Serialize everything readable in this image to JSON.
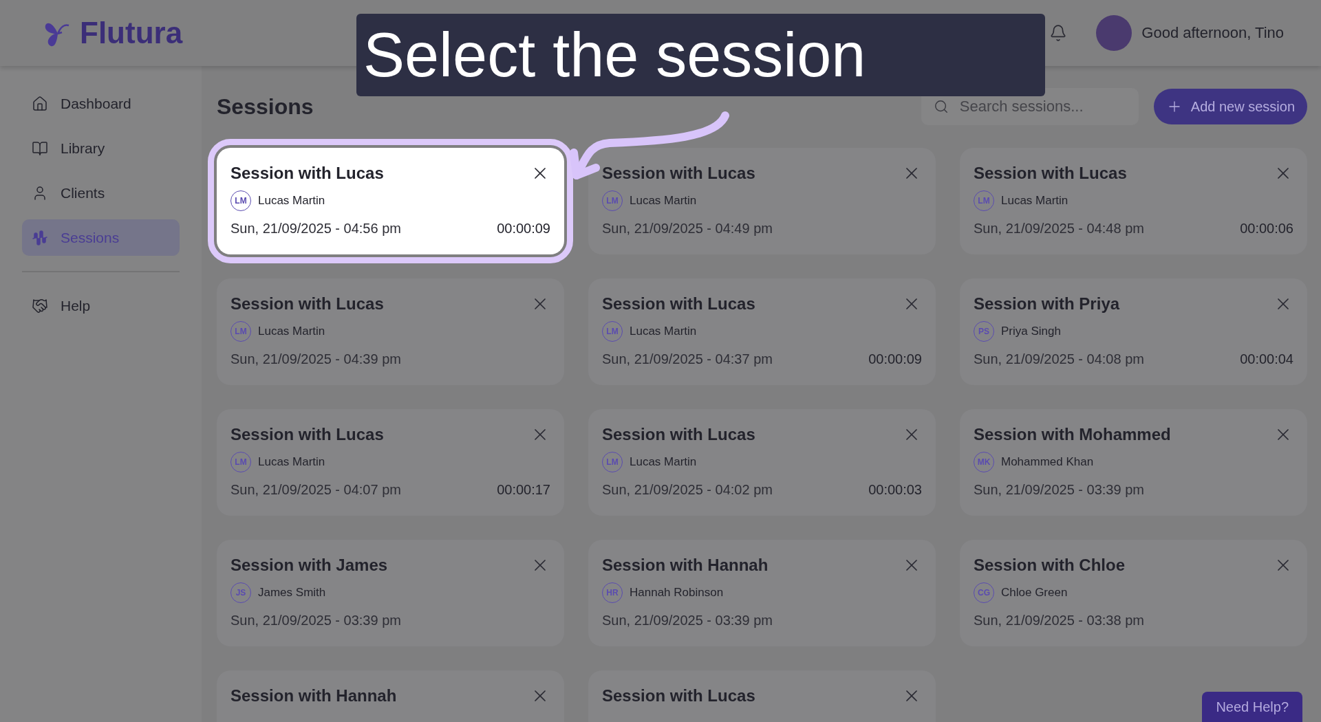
{
  "header": {
    "logo": "Flutura",
    "greeting": "Good afternoon, Tino"
  },
  "callout": {
    "text": "Select the session"
  },
  "sidebar": {
    "items": [
      {
        "label": "Dashboard",
        "selected": false
      },
      {
        "label": "Library",
        "selected": false
      },
      {
        "label": "Clients",
        "selected": false
      },
      {
        "label": "Sessions",
        "selected": true
      }
    ],
    "footer_items": [
      {
        "label": "Help",
        "selected": false
      }
    ]
  },
  "page": {
    "title": "Sessions",
    "search": {
      "placeholder": "Search sessions..."
    },
    "add_button": "Add new session"
  },
  "sessions": [
    {
      "title": "Session with Lucas",
      "initials": "LM",
      "client": "Lucas Martin",
      "datetime": "Sun, 21/09/2025 - 04:56 pm",
      "duration": "00:00:09",
      "selected": true
    },
    {
      "title": "Session with Lucas",
      "initials": "LM",
      "client": "Lucas Martin",
      "datetime": "Sun, 21/09/2025 - 04:49 pm",
      "selected": false
    },
    {
      "title": "Session with Lucas",
      "initials": "LM",
      "client": "Lucas Martin",
      "datetime": "Sun, 21/09/2025 - 04:48 pm",
      "duration": "00:00:06",
      "selected": false
    },
    {
      "title": "Session with Lucas",
      "initials": "LM",
      "client": "Lucas Martin",
      "datetime": "Sun, 21/09/2025 - 04:39 pm",
      "selected": false
    },
    {
      "title": "Session with Lucas",
      "initials": "LM",
      "client": "Lucas Martin",
      "datetime": "Sun, 21/09/2025 - 04:37 pm",
      "duration": "00:00:09",
      "selected": false
    },
    {
      "title": "Session with Priya",
      "initials": "PS",
      "client": "Priya Singh",
      "datetime": "Sun, 21/09/2025 - 04:08 pm",
      "duration": "00:00:04",
      "selected": false
    },
    {
      "title": "Session with Lucas",
      "initials": "LM",
      "client": "Lucas Martin",
      "datetime": "Sun, 21/09/2025 - 04:07 pm",
      "duration": "00:00:17",
      "selected": false
    },
    {
      "title": "Session with Lucas",
      "initials": "LM",
      "client": "Lucas Martin",
      "datetime": "Sun, 21/09/2025 - 04:02 pm",
      "duration": "00:00:03",
      "selected": false
    },
    {
      "title": "Session with Mohammed",
      "initials": "MK",
      "client": "Mohammed Khan",
      "datetime": "Sun, 21/09/2025 - 03:39 pm",
      "selected": false
    },
    {
      "title": "Session with James",
      "initials": "JS",
      "client": "James Smith",
      "datetime": "Sun, 21/09/2025 - 03:39 pm",
      "selected": false
    },
    {
      "title": "Session with Hannah",
      "initials": "HR",
      "client": "Hannah Robinson",
      "datetime": "Sun, 21/09/2025 - 03:39 pm",
      "selected": false
    },
    {
      "title": "Session with Chloe",
      "initials": "CG",
      "client": "Chloe Green",
      "datetime": "Sun, 21/09/2025 - 03:38 pm",
      "selected": false
    },
    {
      "title": "Session with Hannah",
      "selected": false
    },
    {
      "title": "Session with Lucas",
      "selected": false
    }
  ],
  "help_button": "Need Help?"
}
